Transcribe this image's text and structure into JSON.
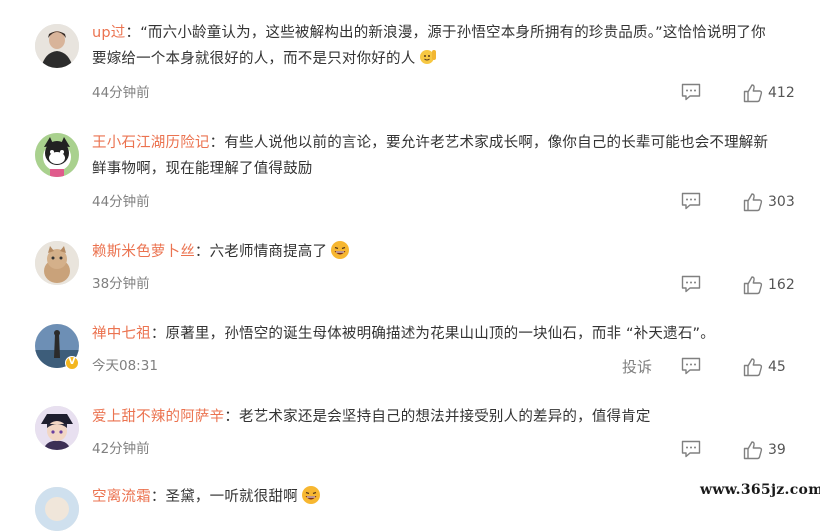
{
  "comments": [
    {
      "user": "up过",
      "text_line1": "“而六小龄童认为，这些被解构出的新浪漫，源于孙悟空本身所拥有的珍贵品质。”这恰恰说明了你",
      "text_line2": "要嫁给一个本身就很好的人，而不是只对你好的人",
      "emoji": "raise-hand-emoji",
      "time": "44分钟前",
      "likes": "412"
    },
    {
      "user": "王小石江湖历险记",
      "text_line1": "有些人说他以前的言论，要允许老艺术家成长啊，像你自己的长辈可能也会不理解新",
      "text_line2": "鲜事物啊，现在能理解了值得鼓励",
      "time": "44分钟前",
      "likes": "303"
    },
    {
      "user": "赖斯米色萝卜丝",
      "text_line1": "六老师情商提高了",
      "emoji": "laughing-emoji",
      "time": "38分钟前",
      "likes": "162"
    },
    {
      "user": "禅中七祖",
      "text_line1": "原著里，孙悟空的诞生母体被明确描述为花果山山顶的一块仙石，而非 “补天遗石”。",
      "time": "今天08:31",
      "report": "投诉",
      "likes": "45",
      "verified": "V"
    },
    {
      "user": "爱上甜不辣的阿萨辛",
      "text_line1": "老艺术家还是会坚持自己的想法并接受别人的差异的，值得肯定",
      "time": "42分钟前",
      "likes": "39"
    },
    {
      "user": "空离流霜",
      "text_line1": "圣黛，一听就很甜啊",
      "emoji": "laughing-emoji"
    }
  ],
  "colon": "：",
  "watermark": "www.365jz.com",
  "colors": {
    "username": "#eb7350",
    "meta": "#808080",
    "text": "#333333"
  }
}
